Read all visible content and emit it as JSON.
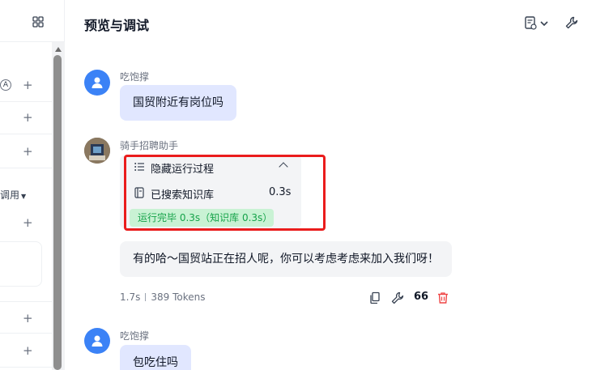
{
  "header": {
    "title": "预览与调试"
  },
  "left_panel": {
    "partial_label": "调用",
    "circle_label": "A",
    "plus_symbol": "+"
  },
  "messages": [
    {
      "role": "user",
      "name": "吃饱撑",
      "text": "国贸附近有岗位吗"
    },
    {
      "role": "bot",
      "name": "骑手招聘助手",
      "process": {
        "toggle_label": "隐藏运行过程",
        "kb_label": "已搜索知识库",
        "kb_time": "0.3s",
        "done_label": "运行完毕 0.3s（知识库 0.3s）"
      },
      "text": "有的哈～国贸站正在招人呢，你可以考虑考虑来加入我们呀！",
      "meta": {
        "latency": "1.7s",
        "tokens": "389 Tokens"
      },
      "quote_label": "66"
    },
    {
      "role": "user",
      "name": "吃饱撑",
      "text": "包吃住吗"
    }
  ],
  "colors": {
    "accent": "#3b82f6",
    "user_bubble": "#e1e7ff",
    "success": "#16a34a",
    "highlight": "#ea1c1c"
  },
  "icons": [
    "grid-icon",
    "settings-doc-icon",
    "chevron-down-icon",
    "wrench-icon",
    "user-icon",
    "list-icon",
    "chevron-up-icon",
    "kb-doc-icon",
    "copy-icon",
    "quote-icon",
    "delete-icon"
  ]
}
